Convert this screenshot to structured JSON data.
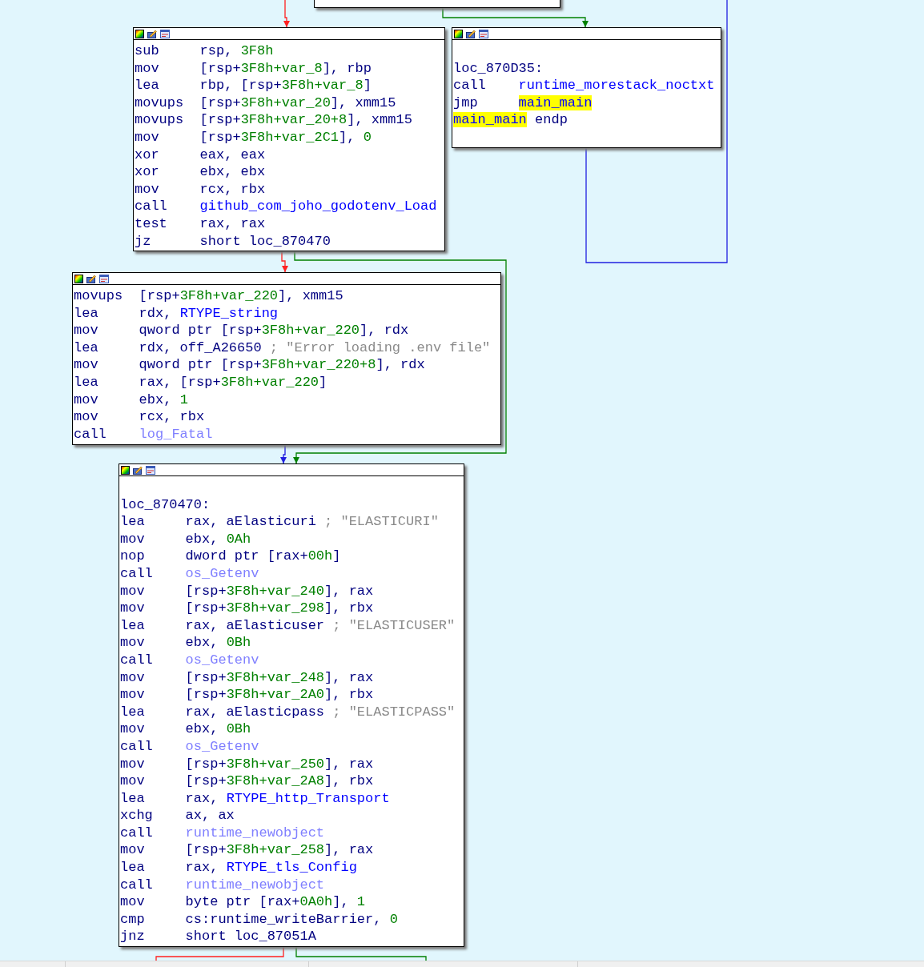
{
  "blocks": [
    {
      "lines": [
        {
          "kind": "ins",
          "mnemonic": "sub",
          "operands": [
            {
              "kind": "text",
              "text": "rsp, "
            },
            {
              "kind": "num",
              "text": "3F8h"
            }
          ]
        },
        {
          "kind": "ins",
          "mnemonic": "mov",
          "operands": [
            {
              "kind": "text",
              "text": "[rsp+"
            },
            {
              "kind": "num",
              "text": "3F8h+var_8"
            },
            {
              "kind": "text",
              "text": "], rbp"
            }
          ]
        },
        {
          "kind": "ins",
          "mnemonic": "lea",
          "operands": [
            {
              "kind": "text",
              "text": "rbp, [rsp+"
            },
            {
              "kind": "num",
              "text": "3F8h+var_8"
            },
            {
              "kind": "text",
              "text": "]"
            }
          ]
        },
        {
          "kind": "ins",
          "mnemonic": "movups",
          "operands": [
            {
              "kind": "text",
              "text": "[rsp+"
            },
            {
              "kind": "num",
              "text": "3F8h+var_20"
            },
            {
              "kind": "text",
              "text": "], xmm15"
            }
          ]
        },
        {
          "kind": "ins",
          "mnemonic": "movups",
          "operands": [
            {
              "kind": "text",
              "text": "[rsp+"
            },
            {
              "kind": "num",
              "text": "3F8h+var_20+8"
            },
            {
              "kind": "text",
              "text": "], xmm15"
            }
          ]
        },
        {
          "kind": "ins",
          "mnemonic": "mov",
          "operands": [
            {
              "kind": "text",
              "text": "[rsp+"
            },
            {
              "kind": "num",
              "text": "3F8h+var_2C1"
            },
            {
              "kind": "text",
              "text": "], "
            },
            {
              "kind": "num",
              "text": "0"
            }
          ]
        },
        {
          "kind": "ins",
          "mnemonic": "xor",
          "operands": [
            {
              "kind": "text",
              "text": "eax, eax"
            }
          ]
        },
        {
          "kind": "ins",
          "mnemonic": "xor",
          "operands": [
            {
              "kind": "text",
              "text": "ebx, ebx"
            }
          ]
        },
        {
          "kind": "ins",
          "mnemonic": "mov",
          "operands": [
            {
              "kind": "text",
              "text": "rcx, rbx"
            }
          ]
        },
        {
          "kind": "ins",
          "mnemonic": "call",
          "operands": [
            {
              "kind": "name",
              "text": "github_com_joho_godotenv_Load"
            }
          ]
        },
        {
          "kind": "ins",
          "mnemonic": "test",
          "operands": [
            {
              "kind": "text",
              "text": "rax, rax"
            }
          ]
        },
        {
          "kind": "ins",
          "mnemonic": "jz",
          "operands": [
            {
              "kind": "text",
              "text": "short loc_870470"
            }
          ]
        }
      ]
    },
    {
      "lines": [
        {
          "kind": "blank"
        },
        {
          "kind": "label",
          "operands": [
            {
              "kind": "text",
              "text": "loc_870D35:"
            }
          ]
        },
        {
          "kind": "ins",
          "mnemonic": "call",
          "operands": [
            {
              "kind": "name",
              "text": "runtime_morestack_noctxt"
            }
          ]
        },
        {
          "kind": "ins",
          "mnemonic": "jmp",
          "operands": [
            {
              "kind": "highlight",
              "text": "main_main"
            }
          ]
        },
        {
          "kind": "label",
          "operands": [
            {
              "kind": "highlight",
              "text": "main_main"
            },
            {
              "kind": "text",
              "text": " endp"
            }
          ]
        }
      ]
    },
    {
      "lines": [
        {
          "kind": "ins",
          "mnemonic": "movups",
          "operands": [
            {
              "kind": "text",
              "text": "[rsp+"
            },
            {
              "kind": "num",
              "text": "3F8h+var_220"
            },
            {
              "kind": "text",
              "text": "], xmm15"
            }
          ]
        },
        {
          "kind": "ins",
          "mnemonic": "lea",
          "operands": [
            {
              "kind": "text",
              "text": "rdx, "
            },
            {
              "kind": "name",
              "text": "RTYPE_string"
            }
          ]
        },
        {
          "kind": "ins",
          "mnemonic": "mov",
          "operands": [
            {
              "kind": "text",
              "text": "qword ptr [rsp+"
            },
            {
              "kind": "num",
              "text": "3F8h+var_220"
            },
            {
              "kind": "text",
              "text": "], rdx"
            }
          ]
        },
        {
          "kind": "ins",
          "mnemonic": "lea",
          "operands": [
            {
              "kind": "text",
              "text": "rdx, off_A26650"
            },
            {
              "kind": "comment",
              "text": " ; \"Error loading .env file\""
            }
          ]
        },
        {
          "kind": "ins",
          "mnemonic": "mov",
          "operands": [
            {
              "kind": "text",
              "text": "qword ptr [rsp+"
            },
            {
              "kind": "num",
              "text": "3F8h+var_220+8"
            },
            {
              "kind": "text",
              "text": "], rdx"
            }
          ]
        },
        {
          "kind": "ins",
          "mnemonic": "lea",
          "operands": [
            {
              "kind": "text",
              "text": "rax, [rsp+"
            },
            {
              "kind": "num",
              "text": "3F8h+var_220"
            },
            {
              "kind": "text",
              "text": "]"
            }
          ]
        },
        {
          "kind": "ins",
          "mnemonic": "mov",
          "operands": [
            {
              "kind": "text",
              "text": "ebx, "
            },
            {
              "kind": "num",
              "text": "1"
            }
          ]
        },
        {
          "kind": "ins",
          "mnemonic": "mov",
          "operands": [
            {
              "kind": "text",
              "text": "rcx, rbx"
            }
          ]
        },
        {
          "kind": "ins",
          "mnemonic": "call",
          "operands": [
            {
              "kind": "import",
              "text": "log_Fatal"
            }
          ]
        }
      ]
    },
    {
      "lines": [
        {
          "kind": "blank"
        },
        {
          "kind": "label",
          "operands": [
            {
              "kind": "text",
              "text": "loc_870470:"
            }
          ]
        },
        {
          "kind": "ins",
          "mnemonic": "lea",
          "operands": [
            {
              "kind": "text",
              "text": "rax, aElasticuri"
            },
            {
              "kind": "comment",
              "text": " ; \"ELASTICURI\""
            }
          ]
        },
        {
          "kind": "ins",
          "mnemonic": "mov",
          "operands": [
            {
              "kind": "text",
              "text": "ebx, "
            },
            {
              "kind": "num",
              "text": "0Ah"
            }
          ]
        },
        {
          "kind": "ins",
          "mnemonic": "nop",
          "operands": [
            {
              "kind": "text",
              "text": "dword ptr [rax+"
            },
            {
              "kind": "num",
              "text": "00h"
            },
            {
              "kind": "text",
              "text": "]"
            }
          ]
        },
        {
          "kind": "ins",
          "mnemonic": "call",
          "operands": [
            {
              "kind": "import",
              "text": "os_Getenv"
            }
          ]
        },
        {
          "kind": "ins",
          "mnemonic": "mov",
          "operands": [
            {
              "kind": "text",
              "text": "[rsp+"
            },
            {
              "kind": "num",
              "text": "3F8h+var_240"
            },
            {
              "kind": "text",
              "text": "], rax"
            }
          ]
        },
        {
          "kind": "ins",
          "mnemonic": "mov",
          "operands": [
            {
              "kind": "text",
              "text": "[rsp+"
            },
            {
              "kind": "num",
              "text": "3F8h+var_298"
            },
            {
              "kind": "text",
              "text": "], rbx"
            }
          ]
        },
        {
          "kind": "ins",
          "mnemonic": "lea",
          "operands": [
            {
              "kind": "text",
              "text": "rax, aElasticuser"
            },
            {
              "kind": "comment",
              "text": " ; \"ELASTICUSER\""
            }
          ]
        },
        {
          "kind": "ins",
          "mnemonic": "mov",
          "operands": [
            {
              "kind": "text",
              "text": "ebx, "
            },
            {
              "kind": "num",
              "text": "0Bh"
            }
          ]
        },
        {
          "kind": "ins",
          "mnemonic": "call",
          "operands": [
            {
              "kind": "import",
              "text": "os_Getenv"
            }
          ]
        },
        {
          "kind": "ins",
          "mnemonic": "mov",
          "operands": [
            {
              "kind": "text",
              "text": "[rsp+"
            },
            {
              "kind": "num",
              "text": "3F8h+var_248"
            },
            {
              "kind": "text",
              "text": "], rax"
            }
          ]
        },
        {
          "kind": "ins",
          "mnemonic": "mov",
          "operands": [
            {
              "kind": "text",
              "text": "[rsp+"
            },
            {
              "kind": "num",
              "text": "3F8h+var_2A0"
            },
            {
              "kind": "text",
              "text": "], rbx"
            }
          ]
        },
        {
          "kind": "ins",
          "mnemonic": "lea",
          "operands": [
            {
              "kind": "text",
              "text": "rax, aElasticpass"
            },
            {
              "kind": "comment",
              "text": " ; \"ELASTICPASS\""
            }
          ]
        },
        {
          "kind": "ins",
          "mnemonic": "mov",
          "operands": [
            {
              "kind": "text",
              "text": "ebx, "
            },
            {
              "kind": "num",
              "text": "0Bh"
            }
          ]
        },
        {
          "kind": "ins",
          "mnemonic": "call",
          "operands": [
            {
              "kind": "import",
              "text": "os_Getenv"
            }
          ]
        },
        {
          "kind": "ins",
          "mnemonic": "mov",
          "operands": [
            {
              "kind": "text",
              "text": "[rsp+"
            },
            {
              "kind": "num",
              "text": "3F8h+var_250"
            },
            {
              "kind": "text",
              "text": "], rax"
            }
          ]
        },
        {
          "kind": "ins",
          "mnemonic": "mov",
          "operands": [
            {
              "kind": "text",
              "text": "[rsp+"
            },
            {
              "kind": "num",
              "text": "3F8h+var_2A8"
            },
            {
              "kind": "text",
              "text": "], rbx"
            }
          ]
        },
        {
          "kind": "ins",
          "mnemonic": "lea",
          "operands": [
            {
              "kind": "text",
              "text": "rax, "
            },
            {
              "kind": "name",
              "text": "RTYPE_http_Transport"
            }
          ]
        },
        {
          "kind": "ins",
          "mnemonic": "xchg",
          "operands": [
            {
              "kind": "text",
              "text": "ax, ax"
            }
          ]
        },
        {
          "kind": "ins",
          "mnemonic": "call",
          "operands": [
            {
              "kind": "import",
              "text": "runtime_newobject"
            }
          ]
        },
        {
          "kind": "ins",
          "mnemonic": "mov",
          "operands": [
            {
              "kind": "text",
              "text": "[rsp+"
            },
            {
              "kind": "num",
              "text": "3F8h+var_258"
            },
            {
              "kind": "text",
              "text": "], rax"
            }
          ]
        },
        {
          "kind": "ins",
          "mnemonic": "lea",
          "operands": [
            {
              "kind": "text",
              "text": "rax, "
            },
            {
              "kind": "name",
              "text": "RTYPE_tls_Config"
            }
          ]
        },
        {
          "kind": "ins",
          "mnemonic": "call",
          "operands": [
            {
              "kind": "import",
              "text": "runtime_newobject"
            }
          ]
        },
        {
          "kind": "ins",
          "mnemonic": "mov",
          "operands": [
            {
              "kind": "text",
              "text": "byte ptr [rax+"
            },
            {
              "kind": "num",
              "text": "0A0h"
            },
            {
              "kind": "text",
              "text": "], "
            },
            {
              "kind": "num",
              "text": "1"
            }
          ]
        },
        {
          "kind": "ins",
          "mnemonic": "cmp",
          "operands": [
            {
              "kind": "text",
              "text": "cs:runtime_writeBarrier, "
            },
            {
              "kind": "num",
              "text": "0"
            }
          ]
        },
        {
          "kind": "ins",
          "mnemonic": "jnz",
          "operands": [
            {
              "kind": "text",
              "text": "short loc_87051A"
            }
          ]
        }
      ]
    }
  ]
}
